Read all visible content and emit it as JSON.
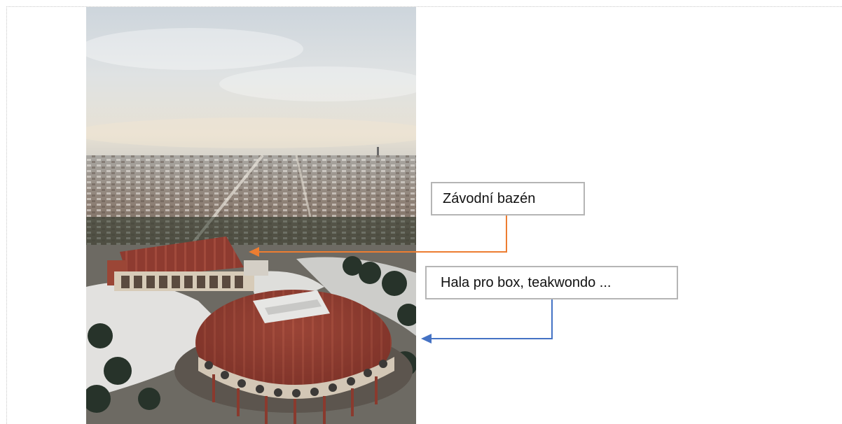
{
  "photo": {
    "subject": "aerial-city-view-with-sports-venues"
  },
  "callouts": {
    "pool_label": "Závodní bazén",
    "hall_label": "Hala pro box, teakwondo ..."
  },
  "colors": {
    "pool_arrow": "#ed7d31",
    "hall_arrow": "#4472c4",
    "callout_border": "#b5b5b5",
    "dome_roof": "#8e3b30"
  }
}
